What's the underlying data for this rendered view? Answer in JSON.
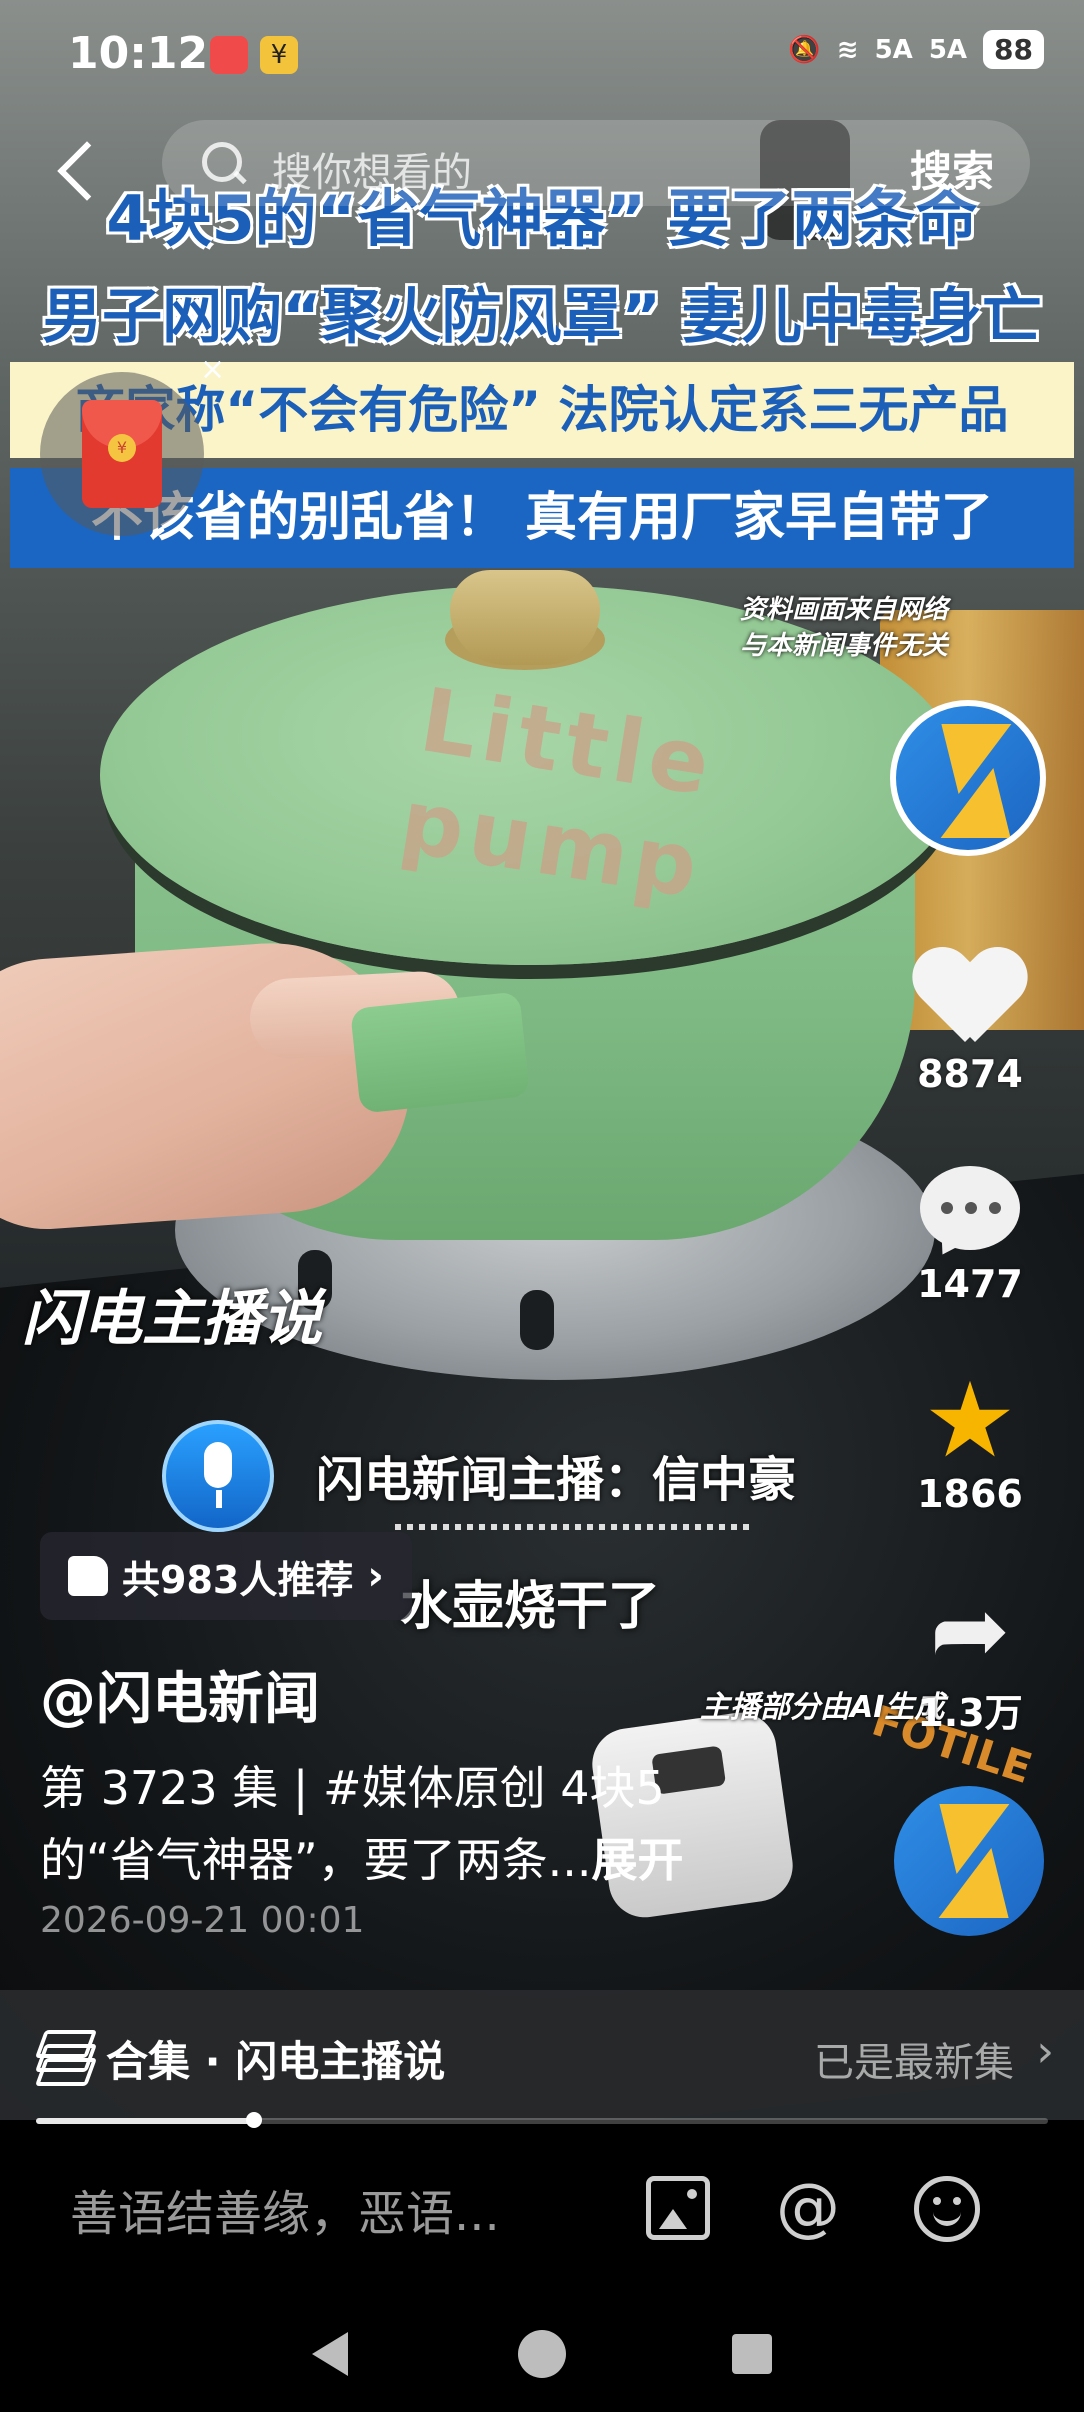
{
  "status_bar": {
    "time": "10:12",
    "signal_1": "5A",
    "signal_2": "5A",
    "battery": "88"
  },
  "search": {
    "placeholder": "搜你想看的",
    "button": "搜索"
  },
  "video": {
    "headlines": [
      "4块5的“省气神器” 要了两条命",
      "男子网购“聚火防风罩” 妻儿中毒身亡",
      "商家称“不会有危险” 法院认定系三无产品",
      "不该省的别乱省！ 真有用厂家早自带了"
    ],
    "disclaimer": "资料画面来自网络\n与本新闻事件无关",
    "pot_logo": "Little pump",
    "brand": "闪电主播说",
    "anchor": "闪电新闻主播：信中豪",
    "subtitle": "水壶烧干了",
    "ai_note": "主播部分由AI生成",
    "stove_brand": "FOTILE"
  },
  "actions": {
    "likes": "8874",
    "comments": "1477",
    "favorites": "1866",
    "shares": "1.3万"
  },
  "recommend": {
    "text": "共983人推荐"
  },
  "post": {
    "author": "@闪电新闻",
    "description": "第 3723 集 | #媒体原创 4块5的“省气神器”，要了两条...",
    "more": "展开",
    "date": "2026-09-21 00:01"
  },
  "collection": {
    "label": "合集 · 闪电主播说",
    "status": "已是最新集"
  },
  "progress": {
    "fraction": 0.215
  },
  "comment": {
    "placeholder": "善语结善缘，恶语..."
  },
  "icons": {
    "red_packet_coin": "¥",
    "status_app_2": "¥"
  }
}
